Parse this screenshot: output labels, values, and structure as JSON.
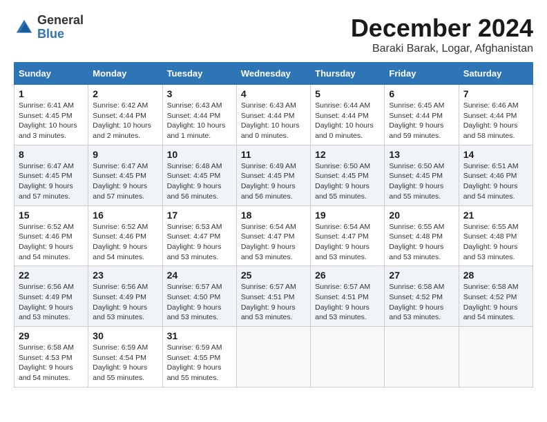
{
  "header": {
    "logo_text_top": "General",
    "logo_text_bottom": "Blue",
    "main_title": "December 2024",
    "subtitle": "Baraki Barak, Logar, Afghanistan"
  },
  "calendar": {
    "days_of_week": [
      "Sunday",
      "Monday",
      "Tuesday",
      "Wednesday",
      "Thursday",
      "Friday",
      "Saturday"
    ],
    "weeks": [
      [
        {
          "day": "1",
          "sunrise": "6:41 AM",
          "sunset": "4:45 PM",
          "daylight": "10 hours and 3 minutes."
        },
        {
          "day": "2",
          "sunrise": "6:42 AM",
          "sunset": "4:44 PM",
          "daylight": "10 hours and 2 minutes."
        },
        {
          "day": "3",
          "sunrise": "6:43 AM",
          "sunset": "4:44 PM",
          "daylight": "10 hours and 1 minute."
        },
        {
          "day": "4",
          "sunrise": "6:43 AM",
          "sunset": "4:44 PM",
          "daylight": "10 hours and 0 minutes."
        },
        {
          "day": "5",
          "sunrise": "6:44 AM",
          "sunset": "4:44 PM",
          "daylight": "10 hours and 0 minutes."
        },
        {
          "day": "6",
          "sunrise": "6:45 AM",
          "sunset": "4:44 PM",
          "daylight": "9 hours and 59 minutes."
        },
        {
          "day": "7",
          "sunrise": "6:46 AM",
          "sunset": "4:44 PM",
          "daylight": "9 hours and 58 minutes."
        }
      ],
      [
        {
          "day": "8",
          "sunrise": "6:47 AM",
          "sunset": "4:45 PM",
          "daylight": "9 hours and 57 minutes."
        },
        {
          "day": "9",
          "sunrise": "6:47 AM",
          "sunset": "4:45 PM",
          "daylight": "9 hours and 57 minutes."
        },
        {
          "day": "10",
          "sunrise": "6:48 AM",
          "sunset": "4:45 PM",
          "daylight": "9 hours and 56 minutes."
        },
        {
          "day": "11",
          "sunrise": "6:49 AM",
          "sunset": "4:45 PM",
          "daylight": "9 hours and 56 minutes."
        },
        {
          "day": "12",
          "sunrise": "6:50 AM",
          "sunset": "4:45 PM",
          "daylight": "9 hours and 55 minutes."
        },
        {
          "day": "13",
          "sunrise": "6:50 AM",
          "sunset": "4:45 PM",
          "daylight": "9 hours and 55 minutes."
        },
        {
          "day": "14",
          "sunrise": "6:51 AM",
          "sunset": "4:46 PM",
          "daylight": "9 hours and 54 minutes."
        }
      ],
      [
        {
          "day": "15",
          "sunrise": "6:52 AM",
          "sunset": "4:46 PM",
          "daylight": "9 hours and 54 minutes."
        },
        {
          "day": "16",
          "sunrise": "6:52 AM",
          "sunset": "4:46 PM",
          "daylight": "9 hours and 54 minutes."
        },
        {
          "day": "17",
          "sunrise": "6:53 AM",
          "sunset": "4:47 PM",
          "daylight": "9 hours and 53 minutes."
        },
        {
          "day": "18",
          "sunrise": "6:54 AM",
          "sunset": "4:47 PM",
          "daylight": "9 hours and 53 minutes."
        },
        {
          "day": "19",
          "sunrise": "6:54 AM",
          "sunset": "4:47 PM",
          "daylight": "9 hours and 53 minutes."
        },
        {
          "day": "20",
          "sunrise": "6:55 AM",
          "sunset": "4:48 PM",
          "daylight": "9 hours and 53 minutes."
        },
        {
          "day": "21",
          "sunrise": "6:55 AM",
          "sunset": "4:48 PM",
          "daylight": "9 hours and 53 minutes."
        }
      ],
      [
        {
          "day": "22",
          "sunrise": "6:56 AM",
          "sunset": "4:49 PM",
          "daylight": "9 hours and 53 minutes."
        },
        {
          "day": "23",
          "sunrise": "6:56 AM",
          "sunset": "4:49 PM",
          "daylight": "9 hours and 53 minutes."
        },
        {
          "day": "24",
          "sunrise": "6:57 AM",
          "sunset": "4:50 PM",
          "daylight": "9 hours and 53 minutes."
        },
        {
          "day": "25",
          "sunrise": "6:57 AM",
          "sunset": "4:51 PM",
          "daylight": "9 hours and 53 minutes."
        },
        {
          "day": "26",
          "sunrise": "6:57 AM",
          "sunset": "4:51 PM",
          "daylight": "9 hours and 53 minutes."
        },
        {
          "day": "27",
          "sunrise": "6:58 AM",
          "sunset": "4:52 PM",
          "daylight": "9 hours and 53 minutes."
        },
        {
          "day": "28",
          "sunrise": "6:58 AM",
          "sunset": "4:52 PM",
          "daylight": "9 hours and 54 minutes."
        }
      ],
      [
        {
          "day": "29",
          "sunrise": "6:58 AM",
          "sunset": "4:53 PM",
          "daylight": "9 hours and 54 minutes."
        },
        {
          "day": "30",
          "sunrise": "6:59 AM",
          "sunset": "4:54 PM",
          "daylight": "9 hours and 55 minutes."
        },
        {
          "day": "31",
          "sunrise": "6:59 AM",
          "sunset": "4:55 PM",
          "daylight": "9 hours and 55 minutes."
        },
        null,
        null,
        null,
        null
      ]
    ]
  }
}
